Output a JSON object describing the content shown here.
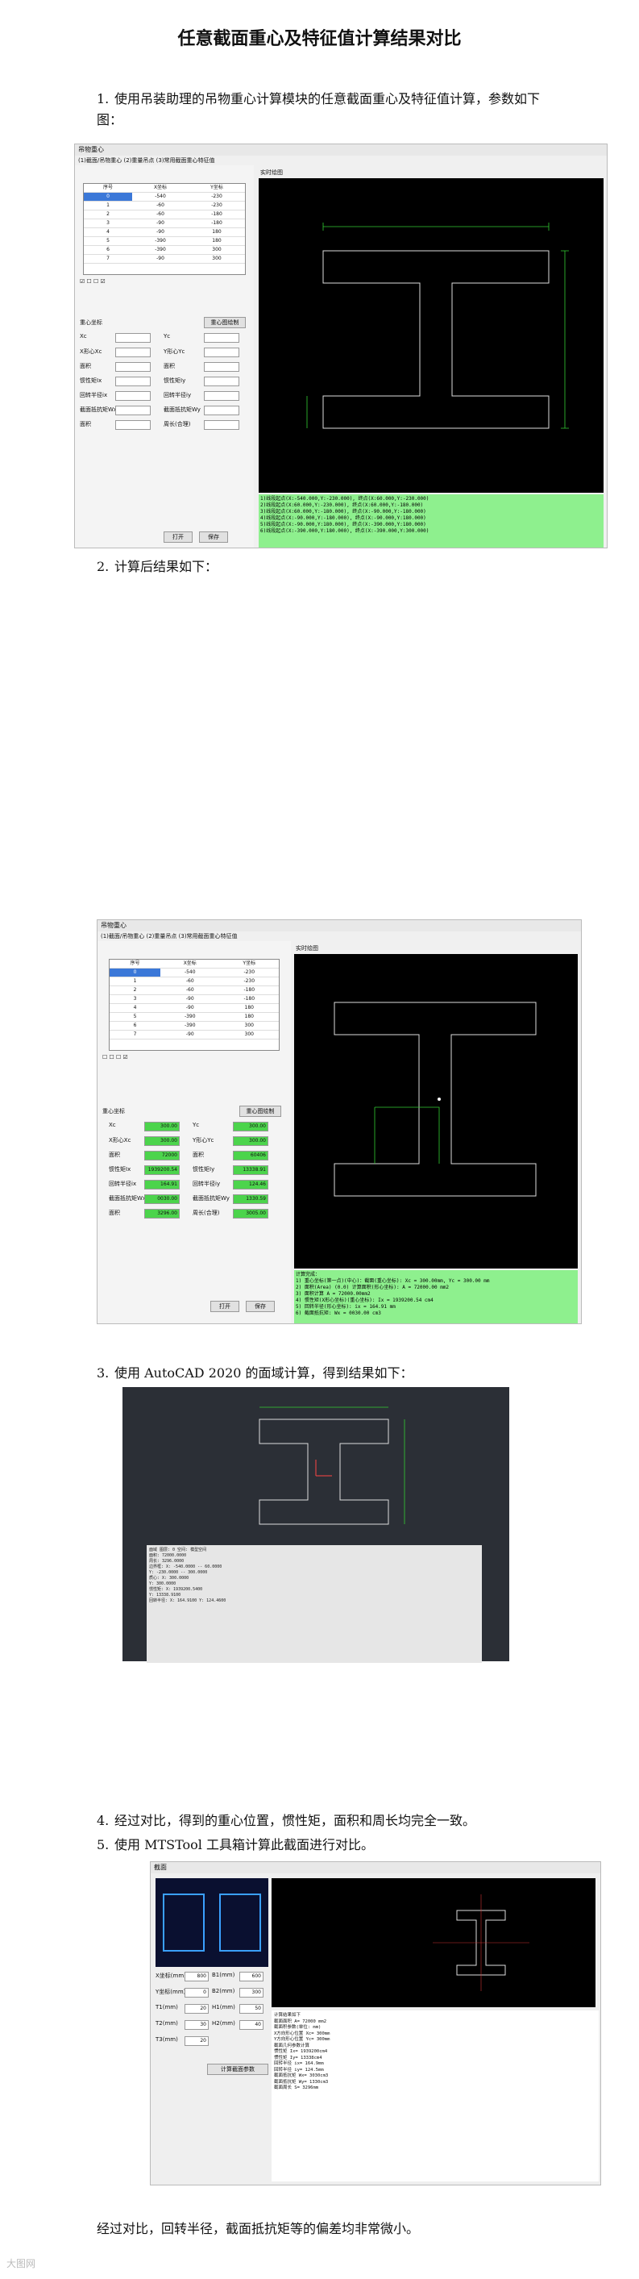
{
  "title": "任意截面重心及特征值计算结果对比",
  "steps": {
    "s1": {
      "num": "1.",
      "text": "使用吊装助理的吊物重心计算模块的任意截面重心及特征值计算，参数如下图："
    },
    "s2": {
      "num": "2.",
      "text": "计算后结果如下："
    },
    "s3": {
      "num": "3.",
      "text": "使用 AutoCAD 2020 的面域计算，得到结果如下："
    },
    "s4": {
      "num": "4.",
      "text": "经过对比，得到的重心位置，惯性矩，面积和周长均完全一致。"
    },
    "s5": {
      "num": "5.",
      "text": "使用 MTSTool 工具箱计算此截面进行对比。"
    }
  },
  "conclusion": "经过对比，回转半径，截面抵抗矩等的偏差均非常微小。",
  "watermark": "大图网",
  "app": {
    "window_title": "吊物重心",
    "tabs": "(1)截面/吊物重心 (2)重量吊点 (3)常用截面重心特征值",
    "headers": [
      "序号",
      "X坐标",
      "Y坐标"
    ],
    "rows": [
      [
        "0",
        "-540",
        "-230"
      ],
      [
        "1",
        "-60",
        "-230"
      ],
      [
        "2",
        "-60",
        "-180"
      ],
      [
        "3",
        "-90",
        "-180"
      ],
      [
        "4",
        "-90",
        "180"
      ],
      [
        "5",
        "-390",
        "180"
      ],
      [
        "6",
        "-390",
        "300"
      ],
      [
        "7",
        "-90",
        "300"
      ]
    ],
    "canvas_label": "实时绘图",
    "panel_title": "重心坐标",
    "calc_button": "重心图绘制",
    "print_button": "打开",
    "save_button": "保存",
    "labels": [
      "Xc",
      "X形心Xc",
      "面积",
      "惯性矩Ix",
      "回转半径ix",
      "截面抵抗矩Wx",
      "面积"
    ],
    "labels2": [
      "Yc",
      "Y形心Yc",
      "面积",
      "惯性矩Iy",
      "回转半径iy",
      "截面抵抗矩Wy",
      "周长(合理)"
    ],
    "result_values": [
      "300.00",
      "300.00",
      "72000",
      "1939200.54",
      "164.91",
      "0030.00",
      "3296.00"
    ],
    "result_values2": [
      "300.00",
      "300.00",
      "60406",
      "13338.91",
      "124.46",
      "1330.59",
      "3005.00"
    ],
    "output1": [
      "1)线段起点(X:-540.000,Y:-230.000), 终点(X:60.000,Y:-230.000)",
      "2)线段起点(X:60.000,Y:-230.000), 终点(X:60.000,Y:-180.000)",
      "3)线段起点(X:60.000,Y:-180.000), 终点(X:-90.000,Y:-180.000)",
      "4)线段起点(X:-90.000,Y:-180.000), 终点(X:-90.000,Y:180.000)",
      "5)线段起点(X:-90.000,Y:180.000), 终点(X:-390.000,Y:180.000)",
      "6)线段起点(X:-390.000,Y:180.000), 终点(X:-390.000,Y:300.000)"
    ],
    "output2": [
      "计算完成：",
      "1) 重心坐标(第一点)(中心)：截面(重心坐标): Xc = 300.00mm, Yc = 300.00 mm",
      "2) 面积(Area) (0.0) 计算面积(形心坐标): A = 72000.00 mm2",
      "3) 面积计算 A = 72000.00mm2",
      "4) 惯性矩(X形心坐标)(重心坐标): Ix = 1939200.54 cm4",
      "5) 回转半径(形心坐标): ix = 164.91 mm",
      "6) 截面抵抗矩: Wx = 0030.00 cm3"
    ]
  },
  "acad_text": [
    "面域 图层: 0 空间: 模型空间",
    "面积: 72000.0000",
    "周长: 3296.0000",
    "边界框: X: -540.0000 -- 60.0000",
    "Y: -230.0000 -- 300.0000",
    "质心: X: 300.0000",
    "Y: 300.0000",
    "惯性矩: X: 1939200.5400",
    "Y: 13338.9100",
    "回转半径: X: 164.9100  Y: 124.4600"
  ],
  "mts": {
    "title": "截面",
    "fields": [
      [
        "X坐标(mm)",
        "800"
      ],
      [
        "Y坐标(mm)",
        "0"
      ],
      [
        "T1(mm)",
        "20"
      ],
      [
        "T2(mm)",
        "30"
      ],
      [
        "T3(mm)",
        "20"
      ]
    ],
    "fields2": [
      [
        "B1(mm)",
        "600"
      ],
      [
        "B2(mm)",
        "300"
      ],
      [
        "H1(mm)",
        "50"
      ],
      [
        "H2(mm)",
        "40"
      ]
    ],
    "button": "计算截面参数",
    "output": [
      "计算结果如下",
      "截面面积 A= 72000 mm2",
      "截面积参数(单位: mm)",
      "X方向形心位置 Xc= 300mm",
      "Y方向形心位置 Yc= 300mm",
      "截面几何参数计算",
      "惯性矩 Ix= 1939200cm4",
      "惯性矩 Iy= 13338cm4",
      "回转半径 ix= 164.9mm",
      "回转半径 iy= 124.5mm",
      "截面抵抗矩 Wx= 3030cm3",
      "截面抵抗矩 Wy= 1330cm3",
      "截面周长 S= 3296mm"
    ]
  }
}
